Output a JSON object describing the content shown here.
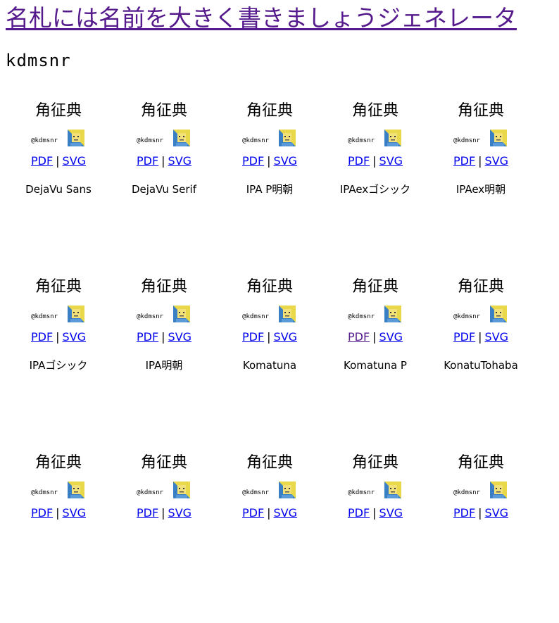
{
  "page": {
    "title": "名札には名前を大きく書きましょうジェネレータ",
    "user_name": "kdmsnr"
  },
  "nameplate": {
    "kanji": "角征典",
    "handle": "@kdmsnr",
    "avatar_icon": "user-avatar-icon"
  },
  "links": {
    "pdf": "PDF",
    "separator": "|",
    "svg": "SVG"
  },
  "fonts": [
    {
      "name": "DejaVu Sans",
      "pdf_visited": false
    },
    {
      "name": "DejaVu Serif",
      "pdf_visited": false
    },
    {
      "name": "IPA P明朝",
      "pdf_visited": false
    },
    {
      "name": "IPAexゴシック",
      "pdf_visited": false
    },
    {
      "name": "IPAex明朝",
      "pdf_visited": false
    },
    {
      "name": "IPAゴシック",
      "pdf_visited": false
    },
    {
      "name": "IPA明朝",
      "pdf_visited": false
    },
    {
      "name": "Komatuna",
      "pdf_visited": false
    },
    {
      "name": "Komatuna P",
      "pdf_visited": true
    },
    {
      "name": "KonatuTohaba",
      "pdf_visited": false
    },
    {
      "name": "",
      "pdf_visited": false
    },
    {
      "name": "",
      "pdf_visited": false
    },
    {
      "name": "",
      "pdf_visited": false
    },
    {
      "name": "",
      "pdf_visited": false
    },
    {
      "name": "",
      "pdf_visited": false
    }
  ],
  "colors": {
    "link": "#0000ee",
    "visited_link": "#551a8b",
    "background": "#ffffff"
  }
}
